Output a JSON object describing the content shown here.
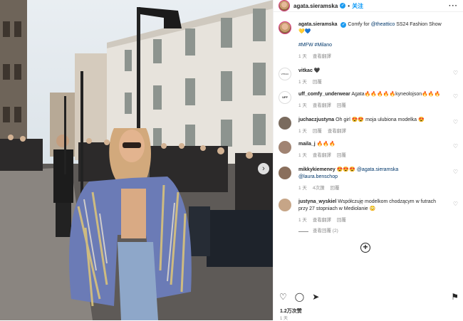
{
  "post": {
    "username": "agata.sieramska",
    "follow_label": "关注",
    "more_label": "···",
    "caption_prefix": "Comfy for ",
    "caption_mention": "@theattico",
    "caption_suffix": " SS24 Fashion Show",
    "caption_emoji": "💛💙",
    "hashtags": "#MFW #Milano",
    "caption_time": "1 天",
    "caption_translate": "查看翻譯"
  },
  "comments": [
    {
      "user": "vitkac",
      "text": "🖤",
      "time": "1 天",
      "reply": "回覆",
      "avatar_color": "#ffffff",
      "avatar_text": "VITKAC"
    },
    {
      "user": "uff_comfy_underwear",
      "text": "Agata🔥🔥🔥🔥🔥kyneolojson🔥🔥🔥",
      "time": "1 天",
      "translate": "查看翻譯",
      "reply": "回覆",
      "avatar_color": "#ffffff",
      "avatar_text": "UFF"
    },
    {
      "user": "juchaczjustyna",
      "text": "Oh girl 😍😍 moja ulubiona modelka 😍",
      "time": "1 天",
      "translate": "查看翻譯",
      "reply": "回覆",
      "avatar_color": "#7a6b5e",
      "avatar_text": ""
    },
    {
      "user": "maila_j",
      "text": "🔥🔥🔥",
      "time": "1 天",
      "translate": "查看翻譯",
      "reply": "回覆",
      "avatar_color": "#a08372",
      "avatar_text": ""
    },
    {
      "user": "mikkykiemeney",
      "text": "😍😍😍",
      "mention": "@agata.sieramska",
      "mention2": "@laura.benschop",
      "time": "1 天",
      "likes": "4次讚",
      "reply": "回覆",
      "avatar_color": "#8a6f5c",
      "avatar_text": ""
    },
    {
      "user": "justyna_wyskiel",
      "text": "Współczuję modelkom chodzącym w futrach przy 27 stopniach w Mediolanie 😳",
      "time": "1 天",
      "translate": "查看翻譯",
      "reply": "回覆",
      "avatar_color": "#c6a587",
      "avatar_text": "",
      "view_replies": "查看回覆 (2)"
    }
  ],
  "footer": {
    "likes": "1.2万次赞",
    "date": "1 天"
  },
  "icons": {
    "like": "heart-icon",
    "comment": "comment-icon",
    "share": "send-icon",
    "save": "bookmark-icon",
    "add": "plus-circle-icon",
    "verified": "verified-badge-icon"
  },
  "colors": {
    "link": "#00376b",
    "follow": "#0095f6",
    "meta": "#8e8e8e",
    "verified": "#1d9bf0"
  }
}
